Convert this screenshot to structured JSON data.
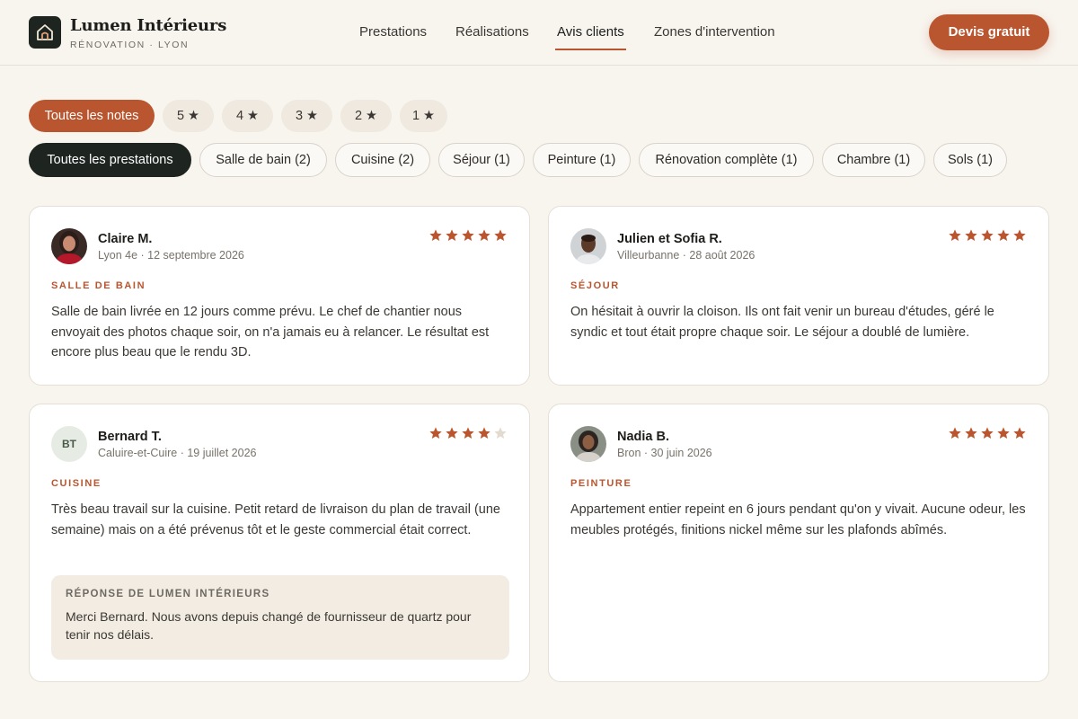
{
  "brand": {
    "name": "Lumen Intérieurs",
    "subtitle": "RÉNOVATION · LYON"
  },
  "nav": {
    "items": [
      "Prestations",
      "Réalisations",
      "Avis clients",
      "Zones d'intervention"
    ],
    "active": "Avis clients"
  },
  "cta_label": "Devis gratuit",
  "rating_filters": [
    "Toutes les notes",
    "5 ★",
    "4 ★",
    "3 ★",
    "2 ★",
    "1 ★"
  ],
  "service_filters": [
    "Toutes les prestations",
    "Salle de bain (2)",
    "Cuisine (2)",
    "Séjour (1)",
    "Peinture (1)",
    "Rénovation complète (1)",
    "Chambre (1)",
    "Sols (1)"
  ],
  "colors": {
    "accent": "#b9552f",
    "dark": "#1e2420",
    "background": "#f8f5ef",
    "star_empty": "#e2dbd0"
  },
  "reviews": [
    {
      "name": "Claire M.",
      "meta": "Lyon 4e · 12 septembre 2026",
      "rating": 5,
      "category": "SALLE DE BAIN",
      "text": "Salle de bain livrée en 12 jours comme prévu. Le chef de chantier nous envoyait des photos chaque soir, on n'a jamais eu à relancer. Le résultat est encore plus beau que le rendu 3D.",
      "avatar": "photo"
    },
    {
      "name": "Julien et Sofia R.",
      "meta": "Villeurbanne · 28 août 2026",
      "rating": 5,
      "category": "SÉJOUR",
      "text": "On hésitait à ouvrir la cloison. Ils ont fait venir un bureau d'études, géré le syndic et tout était propre chaque soir. Le séjour a doublé de lumière.",
      "avatar": "photo"
    },
    {
      "name": "Bernard T.",
      "meta": "Caluire-et-Cuire · 19 juillet 2026",
      "rating": 4,
      "category": "CUISINE",
      "text": "Très beau travail sur la cuisine. Petit retard de livraison du plan de travail (une semaine) mais on a été prévenus tôt et le geste commercial était correct.",
      "avatar": "BT",
      "reply": {
        "title": "RÉPONSE DE LUMEN INTÉRIEURS",
        "text": "Merci Bernard. Nous avons depuis changé de fournisseur de quartz pour tenir nos délais."
      }
    },
    {
      "name": "Nadia B.",
      "meta": "Bron · 30 juin 2026",
      "rating": 5,
      "category": "PEINTURE",
      "text": "Appartement entier repeint en 6 jours pendant qu'on y vivait. Aucune odeur, les meubles protégés, finitions nickel même sur les plafonds abîmés.",
      "avatar": "photo"
    }
  ]
}
